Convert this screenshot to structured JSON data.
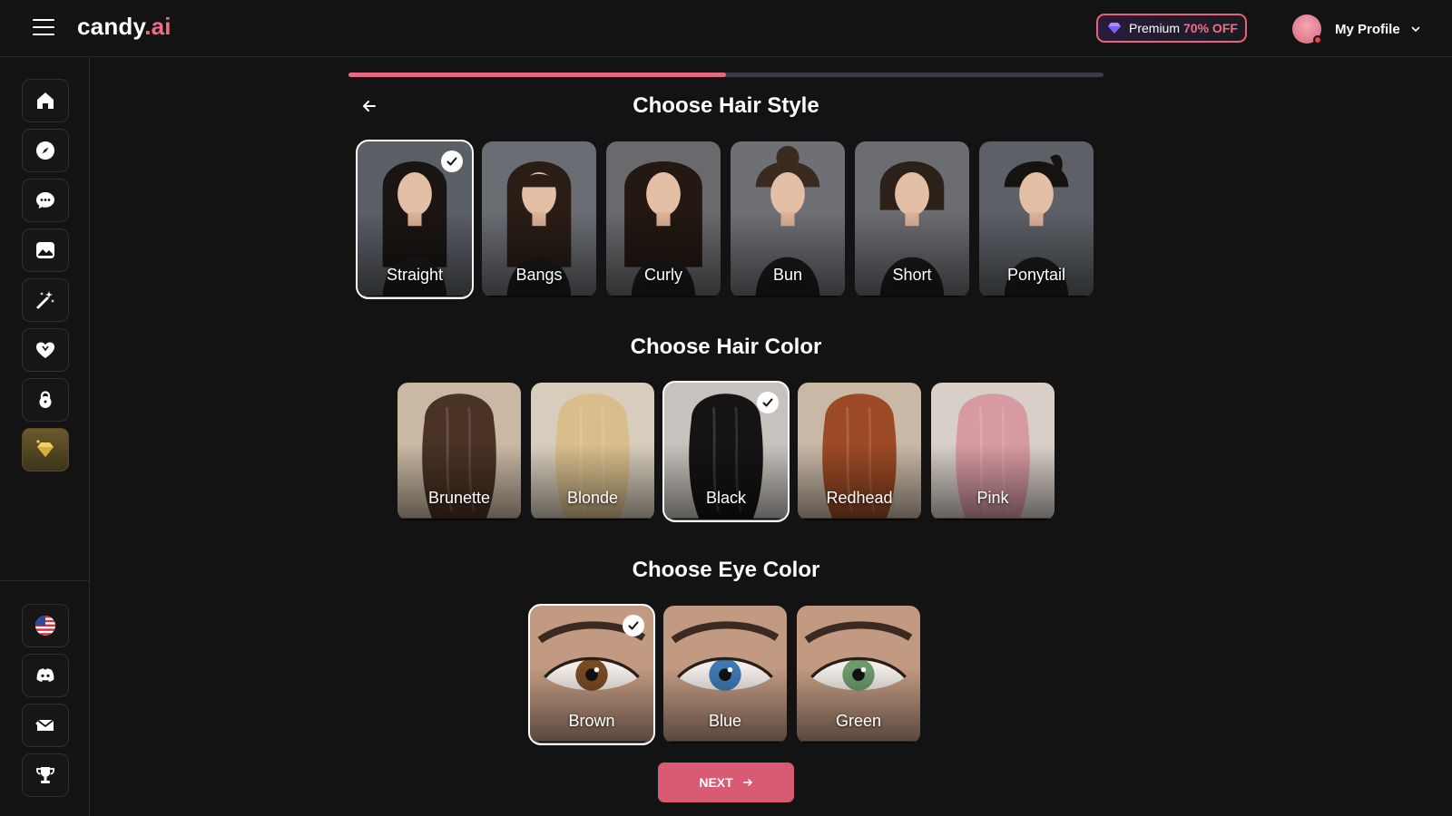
{
  "header": {
    "logo_main": "candy",
    "logo_accent": ".ai",
    "premium_label": "Premium",
    "premium_offer": "70% OFF",
    "profile_label": "My Profile"
  },
  "sidebar": {
    "top_items": [
      "home-icon",
      "compass-icon",
      "chat-icon",
      "gallery-icon",
      "magic-wand-icon",
      "heart-icon",
      "lock-icon",
      "diamond-icon"
    ],
    "bottom_items": [
      "us-flag-icon",
      "discord-icon",
      "mail-icon",
      "trophy-icon"
    ]
  },
  "progress": {
    "value": 0.5
  },
  "hair_style": {
    "title": "Choose Hair Style",
    "selected": "Straight",
    "options": [
      "Straight",
      "Bangs",
      "Curly",
      "Bun",
      "Short",
      "Ponytail"
    ]
  },
  "hair_color": {
    "title": "Choose Hair Color",
    "selected": "Black",
    "options": [
      "Brunette",
      "Blonde",
      "Black",
      "Redhead",
      "Pink"
    ]
  },
  "eye_color": {
    "title": "Choose Eye Color",
    "selected": "Brown",
    "options": [
      "Brown",
      "Blue",
      "Green"
    ]
  },
  "next_label": "NEXT",
  "colors": {
    "accent": "#e66a80",
    "background": "#131313"
  }
}
